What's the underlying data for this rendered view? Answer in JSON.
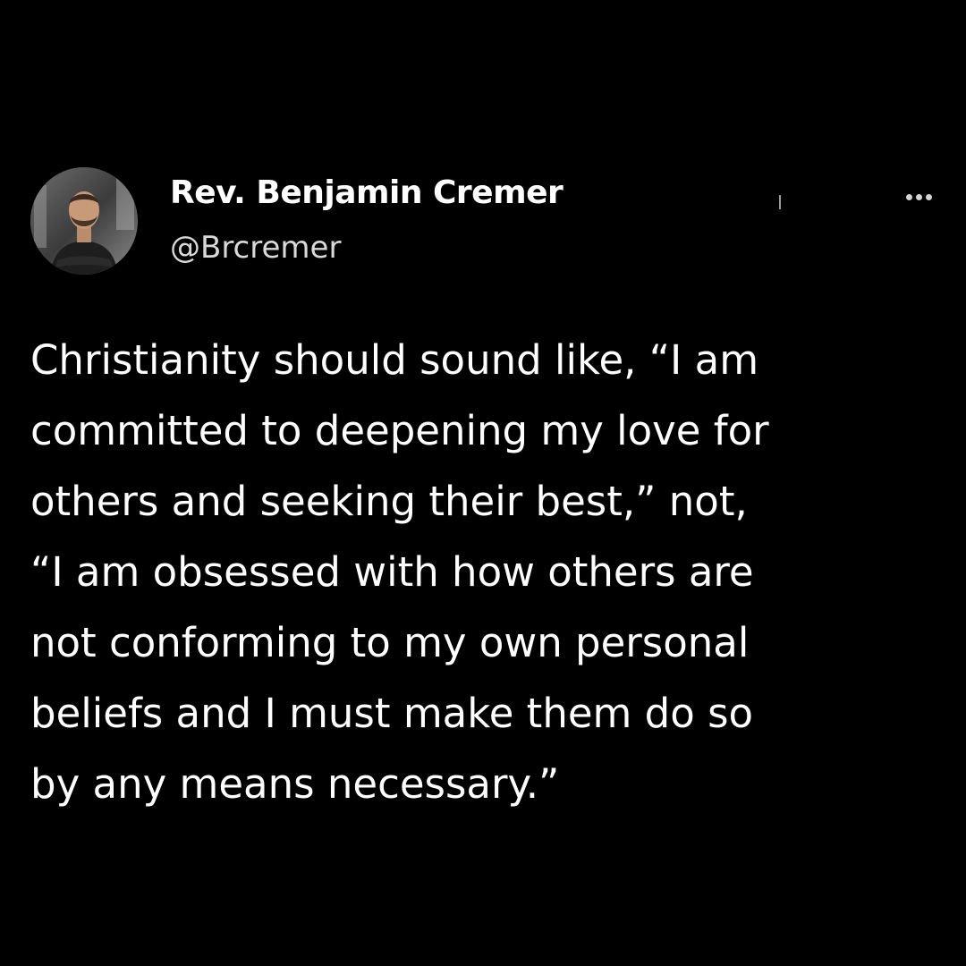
{
  "colors": {
    "background": "#000000",
    "text_primary": "#ffffff",
    "text_secondary": "#d9d9d9"
  },
  "author": {
    "name": "Rev. Benjamin Cremer",
    "handle": "@Brcremer",
    "avatar_icon": "profile-photo-icon"
  },
  "actions": {
    "more_icon": "more-options-icon"
  },
  "tweet": {
    "lines": [
      "Christianity should sound like, “I am",
      "committed to deepening my love for",
      "others and seeking their best,” not,",
      "“I am obsessed with how others are",
      "not conforming to my own personal",
      "beliefs and I must make them do so",
      "by any means necessary.”"
    ]
  }
}
